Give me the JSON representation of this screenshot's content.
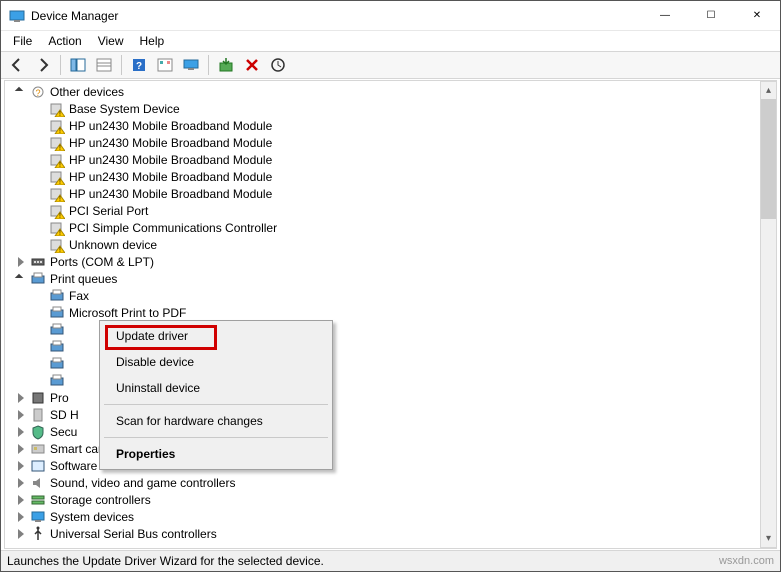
{
  "window": {
    "title": "Device Manager",
    "buttons": {
      "min": "—",
      "max": "☐",
      "close": "✕"
    }
  },
  "menubar": [
    "File",
    "Action",
    "View",
    "Help"
  ],
  "toolbar_icons": [
    "back-icon",
    "forward-icon",
    "show-hide-tree-icon",
    "properties-pane-icon",
    "help-icon",
    "refresh-icon",
    "monitor-icon",
    "install-legacy-icon",
    "uninstall-icon",
    "scan-hardware-icon"
  ],
  "tree": {
    "other_devices": {
      "label": "Other devices",
      "children": [
        "Base System Device",
        "HP un2430 Mobile Broadband Module",
        "HP un2430 Mobile Broadband Module",
        "HP un2430 Mobile Broadband Module",
        "HP un2430 Mobile Broadband Module",
        "HP un2430 Mobile Broadband Module",
        "PCI Serial Port",
        "PCI Simple Communications Controller",
        "Unknown device"
      ]
    },
    "ports": {
      "label": "Ports (COM & LPT)"
    },
    "print_queues": {
      "label": "Print queues",
      "children": [
        "Fax",
        "Microsoft Print to PDF",
        "",
        "",
        "",
        ""
      ]
    },
    "processors": {
      "label": "Pro"
    },
    "sd_host": {
      "label": "SD H"
    },
    "security": {
      "label": "Secu"
    },
    "smart_card": {
      "label": "Smart card readers"
    },
    "software_devices": {
      "label": "Software devices"
    },
    "sound": {
      "label": "Sound, video and game controllers"
    },
    "storage": {
      "label": "Storage controllers"
    },
    "system": {
      "label": "System devices"
    },
    "usb": {
      "label": "Universal Serial Bus controllers"
    }
  },
  "context_menu": {
    "update": "Update driver",
    "disable": "Disable device",
    "uninstall": "Uninstall device",
    "scan": "Scan for hardware changes",
    "properties": "Properties"
  },
  "statusbar": "Launches the Update Driver Wizard for the selected device.",
  "watermark": "wsxdn.com"
}
